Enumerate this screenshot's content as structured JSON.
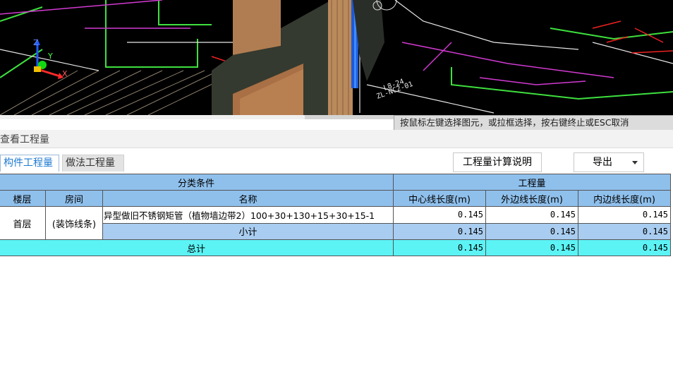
{
  "viewport": {
    "axis_labels": {
      "z": "Z",
      "y": "Y",
      "x": "X"
    },
    "drawing_tags": [
      "L8-24",
      "ZL-NC2-01"
    ]
  },
  "status_tip": "按鼠标左键选择图元，或拉框选择，按右键终止或ESC取消",
  "panel": {
    "title": "查看工程量",
    "tabs": [
      "构件工程量",
      "做法工程量"
    ],
    "active_tab": "构件工程量",
    "calc_note_label": "工程量计算说明",
    "export_label": "导出"
  },
  "table": {
    "group_headers": {
      "category": "分类条件",
      "quantity": "工程量"
    },
    "columns": [
      "楼层",
      "房间",
      "名称",
      "中心线长度(m)",
      "外边线长度(m)",
      "内边线长度(m)"
    ],
    "row": {
      "floor": "首层",
      "room": "(装饰线条)",
      "name": "异型做旧不锈钢矩管（植物墙边带2）100+30+130+15+30+15-1",
      "values": [
        "0.145",
        "0.145",
        "0.145"
      ]
    },
    "subtotal": {
      "label": "小计",
      "values": [
        "0.145",
        "0.145",
        "0.145"
      ]
    },
    "total": {
      "label": "总计",
      "values": [
        "0.145",
        "0.145",
        "0.145"
      ]
    }
  }
}
